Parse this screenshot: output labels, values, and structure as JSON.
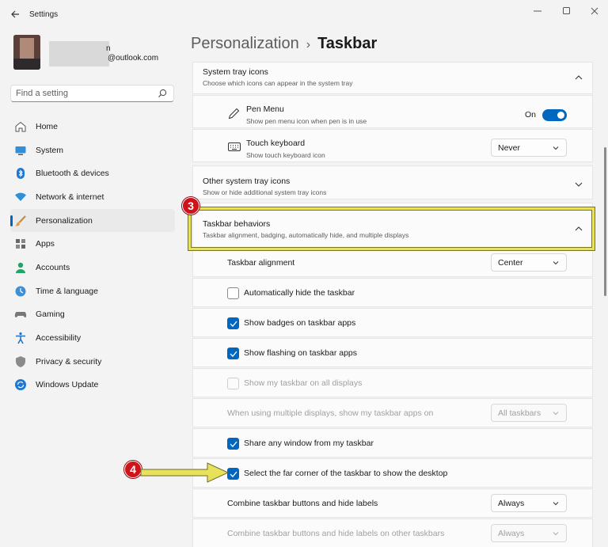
{
  "app": {
    "title": "Settings"
  },
  "profile": {
    "name_tail": "n",
    "email": "@outlook.com"
  },
  "search": {
    "placeholder": "Find a setting"
  },
  "sidebar": {
    "items": [
      {
        "label": "Home",
        "icon": "home-icon"
      },
      {
        "label": "System",
        "icon": "system-icon"
      },
      {
        "label": "Bluetooth & devices",
        "icon": "bluetooth-icon"
      },
      {
        "label": "Network & internet",
        "icon": "wifi-icon"
      },
      {
        "label": "Personalization",
        "icon": "brush-icon",
        "active": true
      },
      {
        "label": "Apps",
        "icon": "apps-icon"
      },
      {
        "label": "Accounts",
        "icon": "account-icon"
      },
      {
        "label": "Time & language",
        "icon": "clock-globe-icon"
      },
      {
        "label": "Gaming",
        "icon": "gamepad-icon"
      },
      {
        "label": "Accessibility",
        "icon": "accessibility-icon"
      },
      {
        "label": "Privacy & security",
        "icon": "shield-icon"
      },
      {
        "label": "Windows Update",
        "icon": "update-icon"
      }
    ]
  },
  "breadcrumb": {
    "parent": "Personalization",
    "separator": "›",
    "current": "Taskbar"
  },
  "tray": {
    "title": "System tray icons",
    "desc": "Choose which icons can appear in the system tray",
    "pen": {
      "title": "Pen Menu",
      "desc": "Show pen menu icon when pen is in use",
      "state": "On"
    },
    "keyboard": {
      "title": "Touch keyboard",
      "desc": "Show touch keyboard icon",
      "value": "Never"
    }
  },
  "other_tray": {
    "title": "Other system tray icons",
    "desc": "Show or hide additional system tray icons"
  },
  "behaviors": {
    "title": "Taskbar behaviors",
    "desc": "Taskbar alignment, badging, automatically hide, and multiple displays",
    "alignment": {
      "label": "Taskbar alignment",
      "value": "Center"
    },
    "auto_hide": {
      "label": "Automatically hide the taskbar",
      "checked": false
    },
    "badges": {
      "label": "Show badges on taskbar apps",
      "checked": true
    },
    "flashing": {
      "label": "Show flashing on taskbar apps",
      "checked": true
    },
    "all_displays": {
      "label": "Show my taskbar on all displays",
      "checked": false,
      "disabled": true
    },
    "multi_display": {
      "label": "When using multiple displays, show my taskbar apps on",
      "value": "All taskbars",
      "disabled": true
    },
    "share_window": {
      "label": "Share any window from my taskbar",
      "checked": true
    },
    "far_corner": {
      "label": "Select the far corner of the taskbar to show the desktop",
      "checked": true
    },
    "combine": {
      "label": "Combine taskbar buttons and hide labels",
      "value": "Always"
    },
    "combine_other": {
      "label": "Combine taskbar buttons and hide labels on other taskbars",
      "value": "Always",
      "disabled": true
    }
  },
  "markers": {
    "step3": "3",
    "step4": "4"
  },
  "colors": {
    "accent": "#0067c0",
    "highlight": "#e8e25a",
    "marker": "#d0121b"
  }
}
